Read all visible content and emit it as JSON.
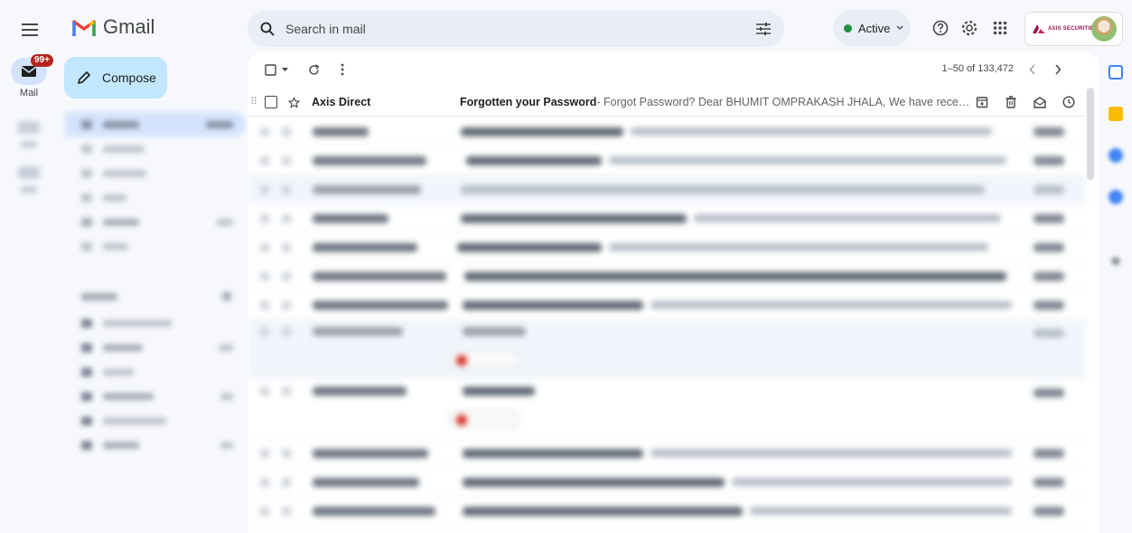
{
  "app": {
    "name": "Gmail"
  },
  "rail": {
    "mail_label": "Mail",
    "unread_badge": "99+"
  },
  "compose": {
    "label": "Compose"
  },
  "search": {
    "placeholder": "Search in mail"
  },
  "status": {
    "label": "Active"
  },
  "account": {
    "org_text": "AXIS SECURITIES"
  },
  "pagination": {
    "range": "1–50 of 133,472"
  },
  "email_rows": [
    {
      "sender": "Axis Direct",
      "subject": "Forgotten your Password",
      "snippet": " - Forgot Password? Dear BHUMIT OMPRAKASH JHALA, We have received a ..."
    }
  ],
  "colors": {
    "compose_bg": "#c2e7ff",
    "active_green": "#1e8e3e",
    "badge_red": "#b3261e",
    "gmail_red": "#ea4335",
    "axis_brand": "#97144d"
  },
  "icons": {
    "menu": "hamburger-icon",
    "search": "search-icon",
    "filters": "tune-icon",
    "help": "help-icon",
    "settings": "gear-icon",
    "apps": "apps-grid-icon",
    "refresh": "refresh-icon",
    "more": "more-vert-icon",
    "archive": "archive-icon",
    "delete": "trash-icon",
    "mark_read": "envelope-open-icon",
    "snooze": "clock-icon"
  }
}
